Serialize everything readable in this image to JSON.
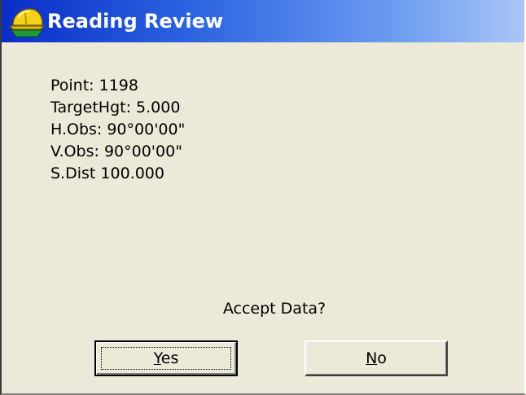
{
  "window": {
    "title": "Reading Review",
    "icon": "survey-helmet-icon"
  },
  "readings": [
    {
      "text": "Point: 1198"
    },
    {
      "text": "TargetHgt: 5.000"
    },
    {
      "text": "H.Obs: 90°00'00\""
    },
    {
      "text": "V.Obs: 90°00'00\""
    },
    {
      "text": "S.Dist 100.000"
    }
  ],
  "prompt": "Accept Data?",
  "buttons": {
    "yes": {
      "accel": "Y",
      "rest": "es",
      "focused": true
    },
    "no": {
      "accel": "N",
      "rest": "o",
      "focused": false
    }
  },
  "colors": {
    "titlebar_start": "#0a2ec6",
    "titlebar_end": "#a9c6f6",
    "dialog_bg": "#ece9d8"
  }
}
